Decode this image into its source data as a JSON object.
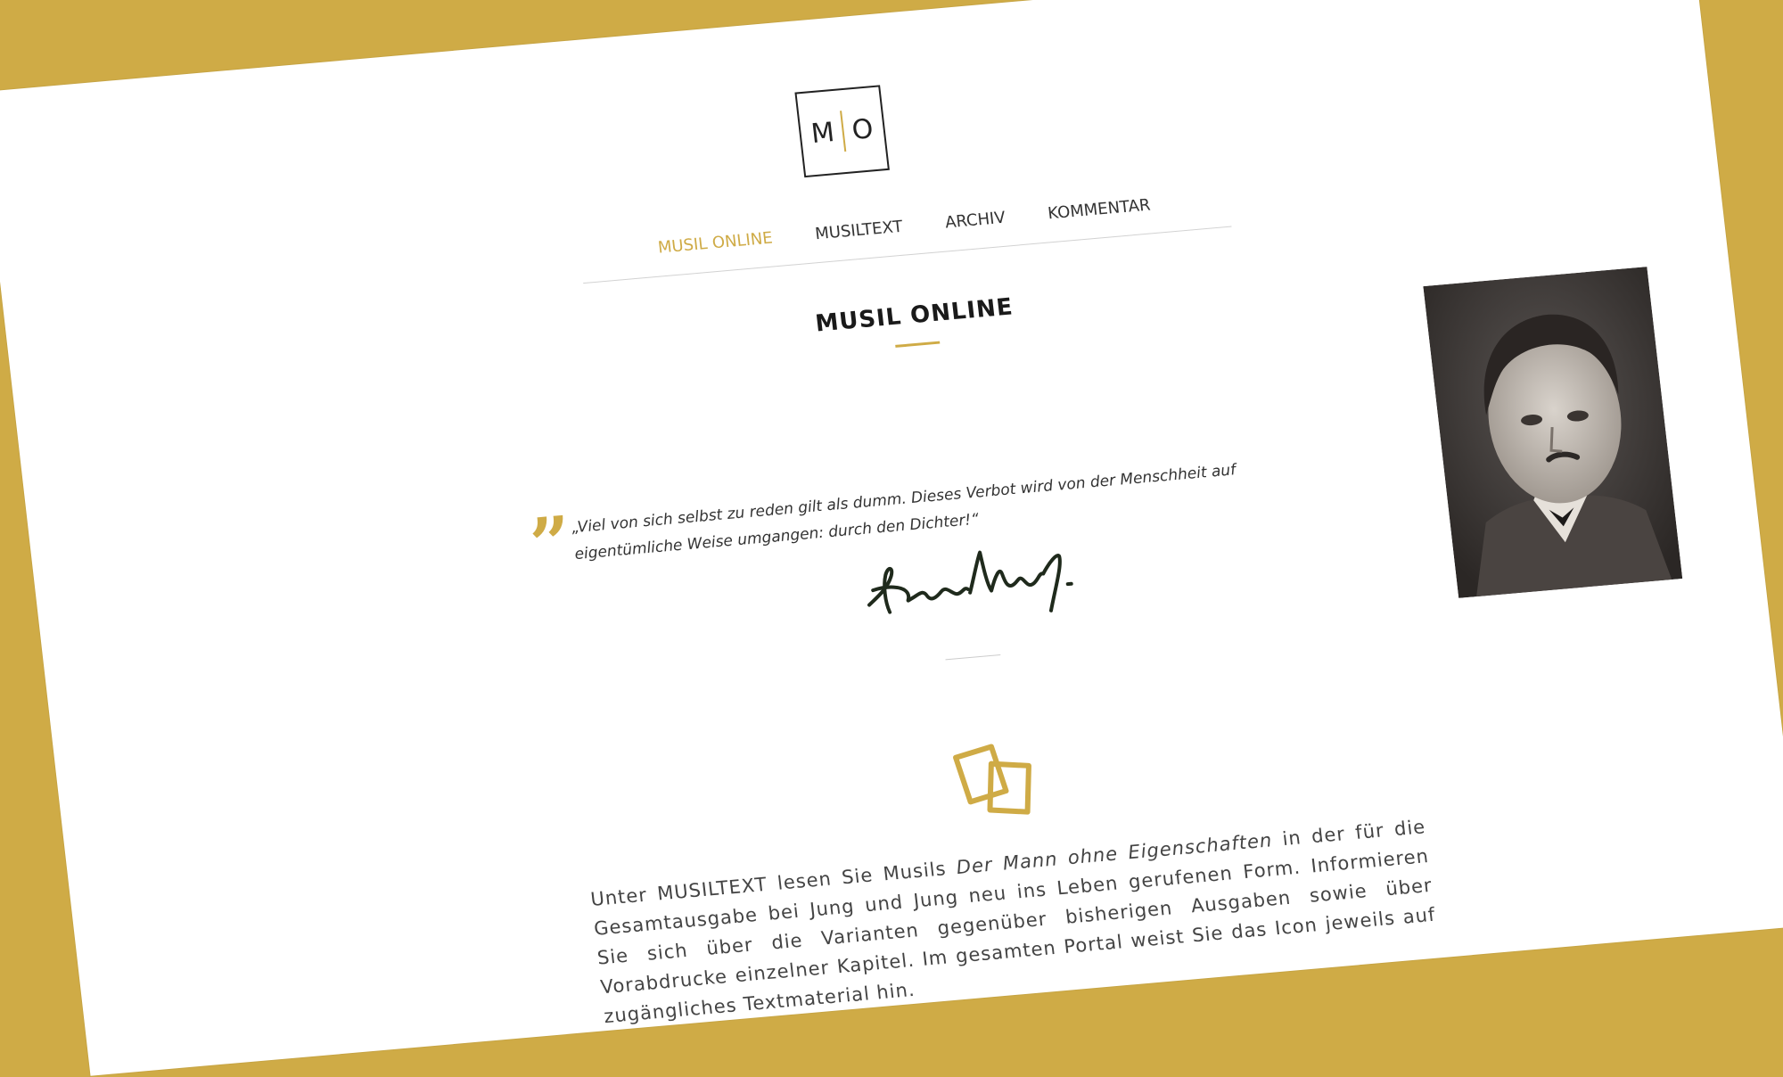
{
  "logo": {
    "left": "M",
    "right": "O"
  },
  "nav": {
    "items": [
      {
        "label": "MUSIL ONLINE",
        "active": true
      },
      {
        "label": "MUSILTEXT",
        "active": false
      },
      {
        "label": "ARCHIV",
        "active": false
      },
      {
        "label": "KOMMENTAR",
        "active": false
      }
    ]
  },
  "page_title": "MUSIL ONLINE",
  "quote": {
    "text": "„Viel von sich selbst zu reden gilt als dumm. Dieses Verbot wird von der Menschheit auf eigentümliche Weise umgangen: durch den Dichter!“"
  },
  "intro": {
    "before": "Unter MUSILTEXT lesen Sie Musils ",
    "book_title": "Der Mann ohne Eigenschaften",
    "after": " in der für die Gesamtausgabe bei Jung und Jung neu ins Leben gerufenen Form. Informieren Sie sich über die Varianten gegenüber bisherigen Ausgaben sowie über Vorabdrucke einzelner Kapitel. Im gesamten Portal weist Sie das Icon jeweils auf zugängliches Textmaterial hin."
  },
  "colors": {
    "accent": "#cfab46",
    "text": "#333333",
    "background": "#ffffff",
    "frame": "#cfab46"
  },
  "icons": [
    "logo-mo",
    "quote-mark-icon",
    "signature",
    "portrait-photo",
    "documents-icon"
  ]
}
